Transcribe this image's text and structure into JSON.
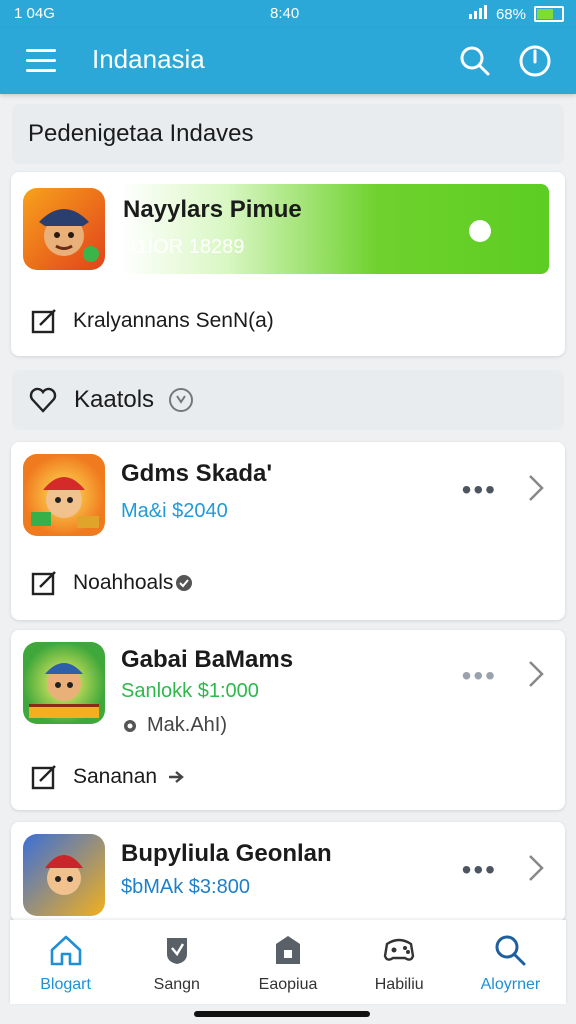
{
  "status_bar": {
    "left": "1 04G",
    "time": "8:40",
    "battery": "68%",
    "colors": {
      "bar": "#2ba8d8"
    }
  },
  "app_bar": {
    "title": "Indanasia",
    "icons": [
      "menu-icon",
      "search-icon",
      "power-icon"
    ]
  },
  "section_header_1": {
    "title": "Pedenigetaa Indaves"
  },
  "featured_card": {
    "title": "Nayylars Pimue",
    "subtitle": "I1IOR 18289",
    "row_text": "Kralyannans SenN(a)",
    "colors": {
      "green_bar": "#6fd12e"
    }
  },
  "section_header_2": {
    "title": "Kaatols"
  },
  "cards": [
    {
      "title": "Gdms Skada'",
      "price": "Ma&i $2040",
      "row_text": "Noahhoals",
      "price_color": "#1f9bd9"
    },
    {
      "title": "Gabai BaMams",
      "price": "Sanlokk  $1:000",
      "secondary": "Mak.AhI)",
      "row_text": "Sananan",
      "price_color": "#2fb84b"
    },
    {
      "title": "Bupyliula Geonlan",
      "price": "$bMAk $3:800",
      "price_color": "#1f7fc9"
    }
  ],
  "bottom_nav": {
    "items": [
      {
        "label": "Blogart",
        "icon": "home-icon"
      },
      {
        "label": "Sangn",
        "icon": "shield-icon"
      },
      {
        "label": "Eaopiua",
        "icon": "store-icon"
      },
      {
        "label": "Habiliu",
        "icon": "gamepad-icon"
      },
      {
        "label": "Aloyrner",
        "icon": "search-icon"
      }
    ],
    "active_color": "#1f8fd6"
  }
}
